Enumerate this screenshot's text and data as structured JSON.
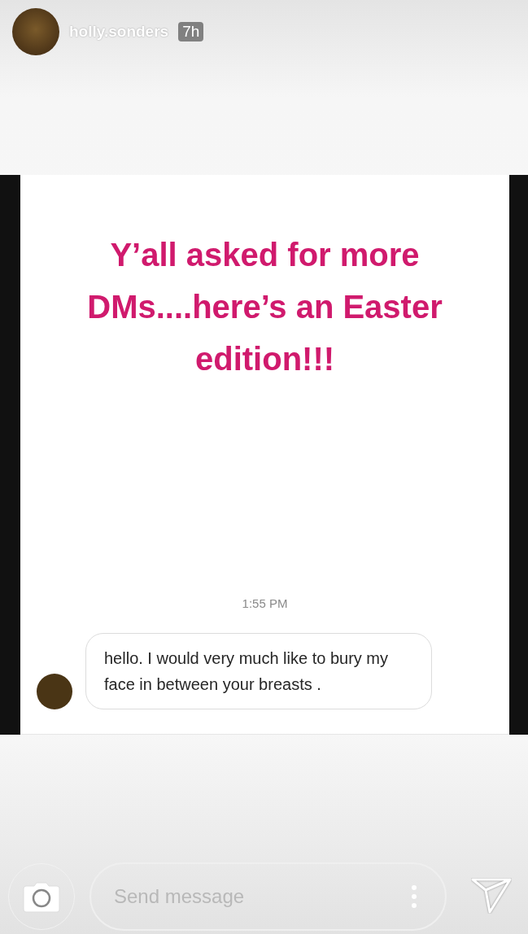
{
  "story_header": {
    "username": "holly.sonders",
    "time": "7h"
  },
  "story": {
    "caption": "Y’all asked for more DMs....here’s an Easter edition!!!",
    "timestamp": "1:55 PM",
    "message": "hello. I would very much like to bury my face in between your breasts ."
  },
  "reply_bar": {
    "placeholder": "Send message"
  }
}
